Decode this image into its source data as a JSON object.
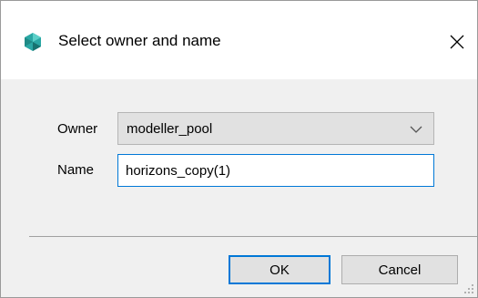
{
  "window": {
    "title": "Select owner and name",
    "app_icon": "app-logo-icon",
    "close_icon": "close-icon"
  },
  "form": {
    "owner_label": "Owner",
    "owner_value": "modeller_pool",
    "owner_dropdown_icon": "chevron-down-icon",
    "name_label": "Name",
    "name_value": "horizons_copy(1)"
  },
  "buttons": {
    "ok_label": "OK",
    "cancel_label": "Cancel"
  },
  "colors": {
    "accent": "#0078d7",
    "logo": "#2aa7a4"
  }
}
